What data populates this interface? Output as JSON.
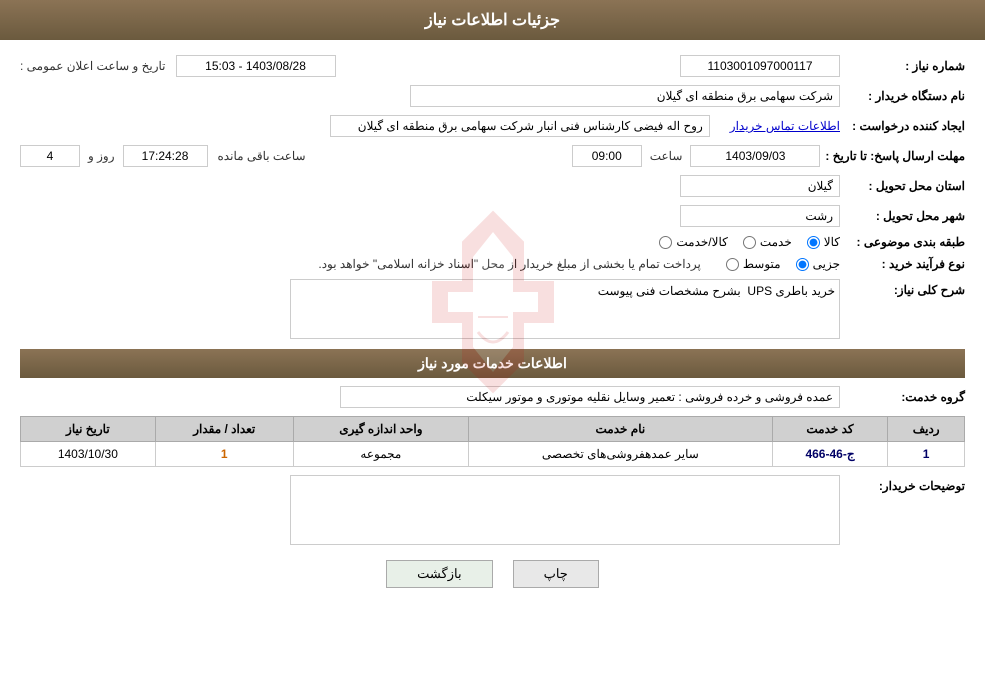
{
  "header": {
    "title": "جزئیات اطلاعات نیاز"
  },
  "form": {
    "need_number_label": "شماره نیاز :",
    "need_number_value": "1103001097000117",
    "announce_date_label": "تاریخ و ساعت اعلان عمومی :",
    "announce_date_value": "1403/08/28 - 15:03",
    "buyer_org_label": "نام دستگاه خریدار :",
    "buyer_org_value": "شرکت سهامی برق منطقه ای گیلان",
    "creator_label": "ایجاد کننده درخواست :",
    "creator_value": "روح اله فیضی کارشناس فنی انبار شرکت سهامی برق منطقه ای گیلان",
    "contact_link": "اطلاعات تماس خریدار",
    "deadline_label": "مهلت ارسال پاسخ: تا تاریخ :",
    "deadline_date": "1403/09/03",
    "deadline_time_label": "ساعت",
    "deadline_time": "09:00",
    "deadline_days_label": "روز و",
    "deadline_days": "4",
    "deadline_remaining_label": "ساعت باقی مانده",
    "deadline_remaining": "17:24:28",
    "province_label": "استان محل تحویل :",
    "province_value": "گیلان",
    "city_label": "شهر محل تحویل :",
    "city_value": "رشت",
    "category_label": "طبقه بندی موضوعی :",
    "category_options": [
      "کالا",
      "خدمت",
      "کالا/خدمت"
    ],
    "category_selected": "کالا",
    "purchase_type_label": "نوع فرآیند خرید :",
    "purchase_type_options": [
      "جزیی",
      "متوسط"
    ],
    "purchase_type_selected": "جزیی",
    "purchase_notice": "پرداخت تمام یا بخشی از مبلغ خریدار از محل \"اسناد خزانه اسلامی\" خواهد بود.",
    "need_description_label": "شرح کلی نیاز:",
    "need_description_value": "خرید باطری UPS  بشرح مشخصات فنی پیوست",
    "services_section_label": "اطلاعات خدمات مورد نیاز",
    "service_group_label": "گروه خدمت:",
    "service_group_value": "عمده فروشی و خرده فروشی : تعمیر وسایل نقلیه موتوری و موتور سیکلت",
    "table": {
      "headers": [
        "ردیف",
        "کد خدمت",
        "نام خدمت",
        "واحد اندازه گیری",
        "تعداد / مقدار",
        "تاریخ نیاز"
      ],
      "rows": [
        {
          "row": "1",
          "code": "ج-46-466",
          "name": "سایر عمدهفروشی‌های تخصصی",
          "unit": "مجموعه",
          "quantity": "1",
          "date": "1403/10/30"
        }
      ]
    },
    "buyer_desc_label": "توضیحات خریدار:",
    "buyer_desc_value": "",
    "btn_print": "چاپ",
    "btn_back": "بازگشت"
  }
}
